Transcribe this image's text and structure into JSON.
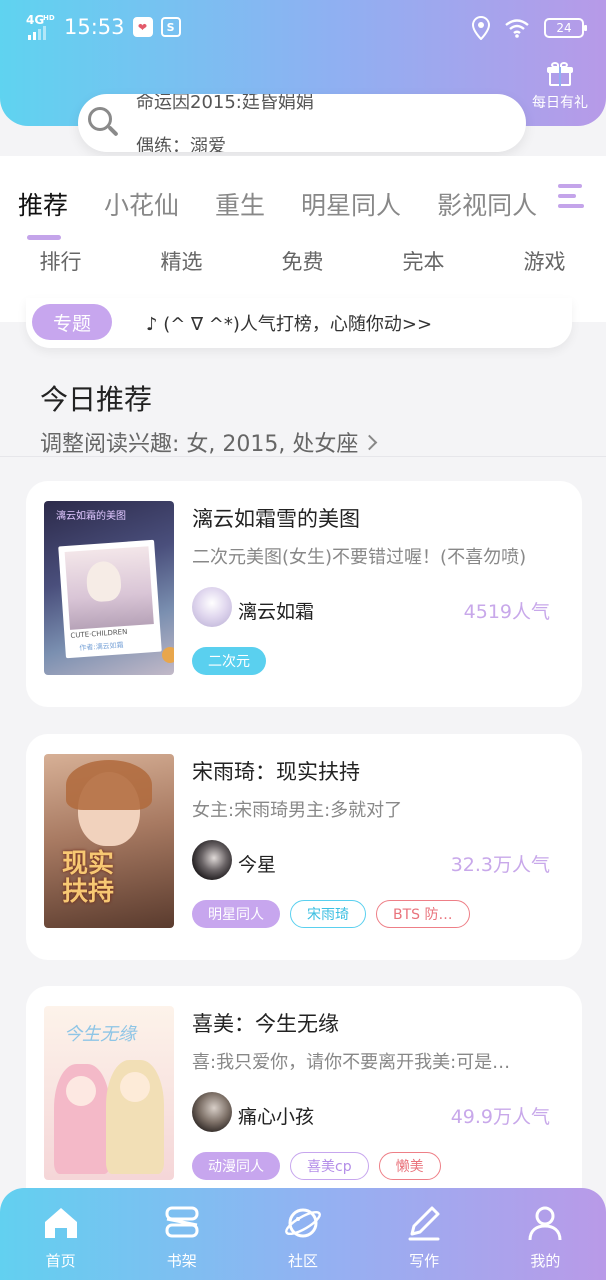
{
  "status": {
    "network": "4G",
    "network_sup": "HD",
    "time": "15:53",
    "battery": "24",
    "icons": [
      "heart-app-icon",
      "s-app-icon",
      "location-icon",
      "wifi-icon"
    ]
  },
  "header": {
    "gift_label": "每日有礼"
  },
  "search": {
    "line1": "命运因2015:廷昏娟娟",
    "line2": "偶练：溺爱"
  },
  "tabs": [
    "推荐",
    "小花仙",
    "重生",
    "明星同人",
    "影视同人"
  ],
  "subtabs": [
    "排行",
    "精选",
    "免费",
    "完本",
    "游戏"
  ],
  "topic": {
    "badge": "专题",
    "text": "♪ (^ ∇ ^*)人气打榜，心随你动>>"
  },
  "section": {
    "title": "今日推荐",
    "subtitle": "调整阅读兴趣: 女, 2015, 处女座"
  },
  "books": [
    {
      "title": "漓云如霜雪的美图",
      "desc": "二次元美图(女生)不要错过喔！(不喜勿喷)",
      "author": "漓云如霜",
      "popularity": "4519人气",
      "cover_text": [
        "漓云如霜的美图",
        "CUTE·CHILDREN",
        "作者:漓云如霜"
      ],
      "tags": [
        {
          "label": "二次元",
          "style": "filled",
          "color": "#5ad0ef"
        }
      ]
    },
    {
      "title": "宋雨琦：现实扶持",
      "desc": "女主:宋雨琦男主:多就对了",
      "author": "今星",
      "popularity": "32.3万人气",
      "cover_text": [
        "现实扶持"
      ],
      "tags": [
        {
          "label": "明星同人",
          "style": "filled",
          "color": "#c7a6ee"
        },
        {
          "label": "宋雨琦",
          "style": "outline",
          "color": "#5ad0ef"
        },
        {
          "label": "BTS  防…",
          "style": "outline",
          "color": "#ee7f87"
        }
      ]
    },
    {
      "title": "喜美：今生无缘",
      "desc": "喜:我只爱你，请你不要离开我美:可是…",
      "author": "痛心小孩",
      "popularity": "49.9万人气",
      "cover_text": [
        "今生无缘"
      ],
      "tags": [
        {
          "label": "动漫同人",
          "style": "filled",
          "color": "#c7a6ee"
        },
        {
          "label": "喜美cp",
          "style": "outline",
          "color": "#c7a6ee"
        },
        {
          "label": "懒美",
          "style": "outline",
          "color": "#ee7f87"
        }
      ]
    }
  ],
  "nav": [
    {
      "label": "首页",
      "icon": "home-icon"
    },
    {
      "label": "书架",
      "icon": "bookshelf-icon"
    },
    {
      "label": "社区",
      "icon": "planet-icon"
    },
    {
      "label": "写作",
      "icon": "pen-icon"
    },
    {
      "label": "我的",
      "icon": "user-icon"
    }
  ]
}
